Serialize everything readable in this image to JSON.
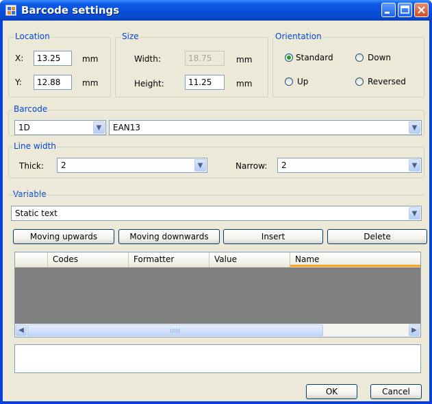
{
  "window": {
    "title": "Barcode settings"
  },
  "location": {
    "caption": "Location",
    "x_label": "X:",
    "x_value": "13.25",
    "x_unit": "mm",
    "y_label": "Y:",
    "y_value": "12.88",
    "y_unit": "mm"
  },
  "size": {
    "caption": "Size",
    "width_label": "Width:",
    "width_value": "18.75",
    "width_unit": "mm",
    "height_label": "Height:",
    "height_value": "11.25",
    "height_unit": "mm"
  },
  "orientation": {
    "caption": "Orientation",
    "options": [
      "Standard",
      "Down",
      "Up",
      "Reversed"
    ],
    "selected": "Standard"
  },
  "barcode": {
    "caption": "Barcode",
    "kind": "1D",
    "type": "EAN13"
  },
  "line_width": {
    "caption": "Line width",
    "thick_label": "Thick:",
    "thick_value": "2",
    "narrow_label": "Narrow:",
    "narrow_value": "2"
  },
  "variable": {
    "caption": "Variable",
    "source": "Static text"
  },
  "buttons": {
    "up": "Moving upwards",
    "down": "Moving downwards",
    "insert": "Insert",
    "delete": "Delete"
  },
  "grid": {
    "columns": [
      "Codes",
      "Formatter",
      "Value",
      "Name"
    ]
  },
  "dialog": {
    "ok": "OK",
    "cancel": "Cancel"
  },
  "colors": {
    "title_bar": "#0a4fd9",
    "client_bg": "#ece9d8",
    "group_caption": "#0046d5",
    "grid_bg": "#808080",
    "active_column_accent": "#f5a623"
  }
}
